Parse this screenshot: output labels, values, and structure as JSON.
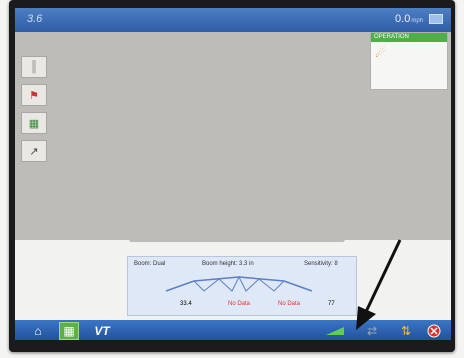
{
  "topbar": {
    "gps_text": "3.6",
    "speed_value": "0.0",
    "speed_unit": "mph"
  },
  "left_tools": [
    {
      "icon": "boom-icon",
      "glyph": "║"
    },
    {
      "icon": "flag-icon",
      "glyph": "⚑"
    },
    {
      "icon": "field-icon",
      "glyph": "▦"
    },
    {
      "icon": "guidance-icon",
      "glyph": "↗"
    }
  ],
  "overview": {
    "header": "OPERATION"
  },
  "boom_panel": {
    "label_left": "Boom: Dual",
    "label_mid": "Boom height: 3.3 in",
    "label_right": "Sensitivity: 8",
    "values": [
      "33.4",
      "No Data",
      "No Data",
      "77"
    ]
  },
  "taskbar": {
    "vt_label": "VT"
  },
  "colors": {
    "accent": "#2f5da6",
    "green": "#4fae49",
    "alert": "#d33"
  }
}
